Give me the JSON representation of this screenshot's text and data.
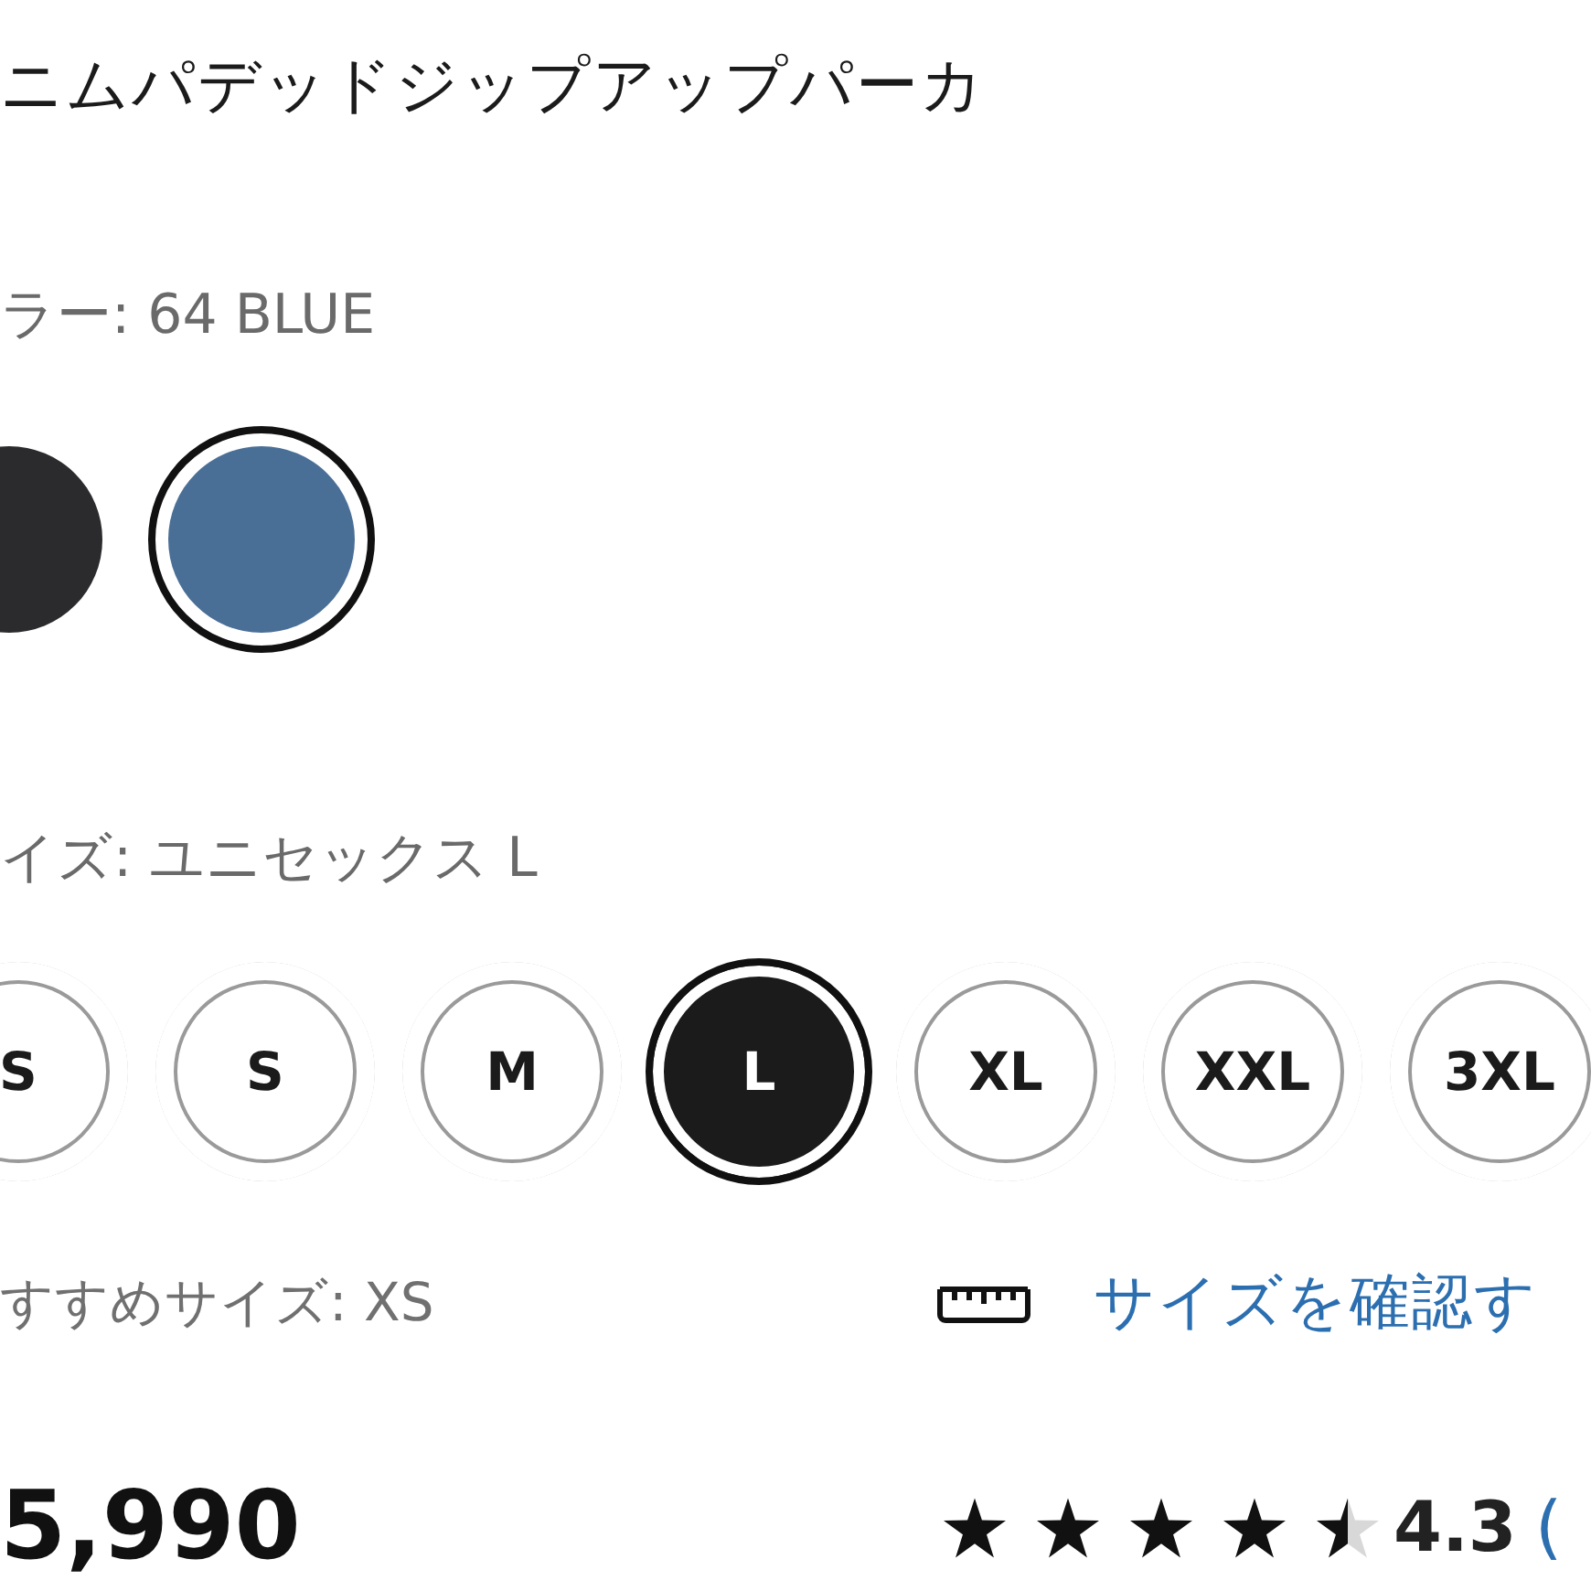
{
  "product": {
    "title": "ニムパデッドジップアップパーカ"
  },
  "color": {
    "label": "ラー: 64 BLUE",
    "swatches": [
      {
        "color": "#2b2b2d",
        "selected": false
      },
      {
        "color": "#4a6f97",
        "selected": true
      }
    ]
  },
  "size": {
    "label": "イズ: ユニセックス L",
    "options": [
      {
        "label": "S",
        "selected": false
      },
      {
        "label": "S",
        "selected": false
      },
      {
        "label": "M",
        "selected": false
      },
      {
        "label": "L",
        "selected": true
      },
      {
        "label": "XL",
        "selected": false
      },
      {
        "label": "XXL",
        "selected": false
      },
      {
        "label": "3XL",
        "selected": false
      }
    ]
  },
  "recommend": {
    "text": "すすめサイズ: XS",
    "link": "サイズを確認す"
  },
  "price": "5,990",
  "rating": {
    "stars": 4.5,
    "value": "4.3",
    "count": "("
  }
}
